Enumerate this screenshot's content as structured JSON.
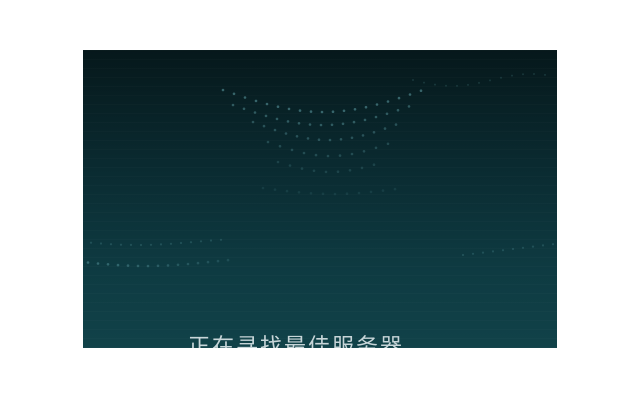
{
  "screen": {
    "status_text": "正在寻找最佳服务器"
  },
  "theme": {
    "background_top": "#06181b",
    "background_bottom": "#114249",
    "dot_color": "#5f9fa6",
    "text_color": "#c7d5d8"
  },
  "decor": {
    "icon": "dotted-wave-pattern"
  }
}
